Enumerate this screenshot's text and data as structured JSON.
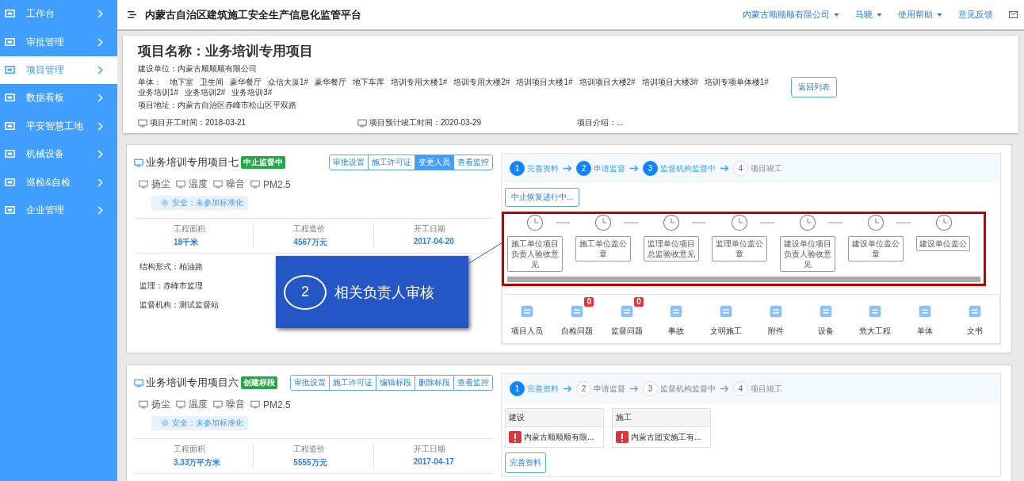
{
  "sidebar": {
    "items": [
      {
        "label": "工作台",
        "selected": false
      },
      {
        "label": "审批管理",
        "selected": false
      },
      {
        "label": "项目管理",
        "selected": true
      },
      {
        "label": "数据看板",
        "selected": false
      },
      {
        "label": "平安智慧工地",
        "selected": false
      },
      {
        "label": "机械设备",
        "selected": false
      },
      {
        "label": "巡检&自检",
        "selected": false
      },
      {
        "label": "企业管理",
        "selected": false
      }
    ]
  },
  "header": {
    "title": "内蒙古自治区建筑施工安全生产信息化监管平台",
    "menus": [
      {
        "label": "内蒙古顺顺顺有限公司",
        "dropdown": true
      },
      {
        "label": "马晓",
        "dropdown": true
      },
      {
        "label": "使用帮助",
        "dropdown": true
      },
      {
        "label": "意见反馈",
        "dropdown": false
      }
    ]
  },
  "project": {
    "name": "项目名称：业务培训专用项目",
    "builder": "建设单位：内蒙古顺顺顺有限公司",
    "units_label": "单体：",
    "units": [
      "地下室",
      "卫生间",
      "豪华餐厅",
      "众信大厦1#",
      "豪华餐厅",
      "地下车库",
      "培训专用大楼1#",
      "培训专用大楼2#",
      "培训项目大楼1#",
      "培训项目大楼2#",
      "培训项目大楼3#",
      "培训专项单体楼1#",
      "业务培训1#",
      "业务培训2#",
      "业务培训3#"
    ],
    "back_button": "返回列表",
    "address": "项目地址：内蒙古自治区赤峰市松山区平双路",
    "start_time": "项目开工时间：2018-03-21",
    "planned_completion": "项目预计竣工时间：2020-03-29",
    "intro": "项目介绍：..."
  },
  "cards": [
    {
      "title": "业务培训专用项目七",
      "status": "中止监督中",
      "actions": [
        {
          "label": "审批设置",
          "selected": false
        },
        {
          "label": "施工许可证",
          "selected": false
        },
        {
          "label": "变更人员",
          "selected": true
        },
        {
          "label": "查看监控",
          "selected": false
        }
      ],
      "sensors": [
        "扬尘",
        "温度",
        "噪音",
        "PM2.5"
      ],
      "safety": "安全：未参加标准化",
      "stats": [
        {
          "label": "工程面积",
          "value": "18千米"
        },
        {
          "label": "工程造价",
          "value": "4567万元"
        },
        {
          "label": "开工日期",
          "value": "2017-04-20"
        }
      ],
      "details": [
        "结构形式：柏油路",
        "监理：赤峰市监理",
        "监督机构：测试监督站"
      ],
      "steps": [
        {
          "number": "1",
          "label": "完善资料",
          "done": true
        },
        {
          "number": "2",
          "label": "申请监督",
          "done": true
        },
        {
          "number": "3",
          "label": "监督机构监督中",
          "done": true
        },
        {
          "number": "4",
          "label": "项目竣工",
          "done": false
        }
      ],
      "resume_button": "中止恢复进行中...",
      "flow": {
        "highlighted": true,
        "nodes": [
          "施工单位项目负责人验收意见",
          "施工单位盖公章",
          "监理单位项目总监验收意见",
          "监理单位盖公章",
          "建设单位项目负责人验收意见",
          "建设单位盖公章",
          "建设单位盖公"
        ]
      },
      "modules": [
        {
          "label": "项目人员"
        },
        {
          "label": "自检问题",
          "badge": "0"
        },
        {
          "label": "监督问题",
          "badge": "0"
        },
        {
          "label": "事故"
        },
        {
          "label": "文明施工"
        },
        {
          "label": "附件"
        },
        {
          "label": "设备"
        },
        {
          "label": "危大工程"
        },
        {
          "label": "单体"
        },
        {
          "label": "文书"
        }
      ],
      "callout": {
        "number": "2",
        "text": "相关负责人审核"
      }
    },
    {
      "title": "业务培训专用项目六",
      "status": "创建标段",
      "actions": [
        {
          "label": "审批设置",
          "selected": false
        },
        {
          "label": "施工许可证",
          "selected": false
        },
        {
          "label": "编辑标段",
          "selected": false
        },
        {
          "label": "删除标段",
          "selected": false
        },
        {
          "label": "查看监控",
          "selected": false
        }
      ],
      "sensors": [
        "扬尘",
        "温度",
        "噪音",
        "PM2.5"
      ],
      "safety": "安全：未参加标准化",
      "stats": [
        {
          "label": "工程面积",
          "value": "3.33万平方米"
        },
        {
          "label": "工程造价",
          "value": "5555万元"
        },
        {
          "label": "开工日期",
          "value": "2017-04-17"
        }
      ],
      "steps": [
        {
          "number": "1",
          "label": "完善资料",
          "done": true
        },
        {
          "number": "2",
          "label": "申请监督",
          "done": false
        },
        {
          "number": "3",
          "label": "监督机构监督中",
          "done": false
        },
        {
          "number": "4",
          "label": "项目竣工",
          "done": false
        }
      ],
      "parties": [
        {
          "role": "建设",
          "company": "内蒙古顺顺顺有限..."
        },
        {
          "role": "施工",
          "company": "内蒙古团安施工有..."
        }
      ],
      "complete_button": "完善资料"
    }
  ]
}
